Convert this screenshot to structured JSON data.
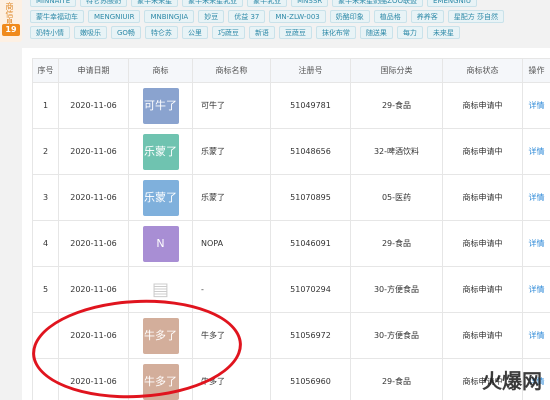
{
  "tags": {
    "row1": [
      "MINNAITE",
      "特仑苏酸奶",
      "蒙牛未来星",
      "蒙牛未来星乳业",
      "蒙牛乳业",
      "MNSSR",
      "蒙牛未来星奶酪ZOO联盟",
      "EMENGNIU"
    ],
    "row2": [
      "蒙牛幸福动车",
      "MENGNIUIR",
      "MNBINGJIA",
      "妙豆",
      "优益 37",
      "MN-ZLW-003",
      "奶酪印象",
      "植品格",
      "养养客",
      "星配方 莎自然"
    ],
    "row3": [
      "奶特小情",
      "嫩吸乐",
      "GO畅",
      "特仑苏",
      "公里",
      "巧蔬豆",
      "新语",
      "豆蔬豆",
      "抹化布常",
      "随送果",
      "每力",
      "未来星"
    ]
  },
  "side": {
    "label": "商信息",
    "count": "19"
  },
  "table": {
    "headers": [
      "序号",
      "申请日期",
      "商标",
      "商标名称",
      "注册号",
      "国际分类",
      "商标状态",
      "操作"
    ],
    "rows": [
      {
        "no": "1",
        "date": "2020-11-06",
        "logo_text": "可牛了",
        "logo_color": "#8aa3cf",
        "name": "可牛了",
        "reg": "51049781",
        "class": "29-食品",
        "status": "商标申请中",
        "action": "详情"
      },
      {
        "no": "2",
        "date": "2020-11-06",
        "logo_text": "乐蒙了",
        "logo_color": "#6fc3b0",
        "name": "乐蒙了",
        "reg": "51048656",
        "class": "32-啤酒饮料",
        "status": "商标申请中",
        "action": "详情"
      },
      {
        "no": "3",
        "date": "2020-11-06",
        "logo_text": "乐蒙了",
        "logo_color": "#7fb0dc",
        "name": "乐蒙了",
        "reg": "51070895",
        "class": "05-医药",
        "status": "商标申请中",
        "action": "详情"
      },
      {
        "no": "4",
        "date": "2020-11-06",
        "logo_text": "N",
        "logo_color": "#a88ed4",
        "name": "NOPA",
        "reg": "51046091",
        "class": "29-食品",
        "status": "商标申请中",
        "action": "详情"
      },
      {
        "no": "5",
        "date": "2020-11-06",
        "logo_text": "▤",
        "logo_color": "transparent",
        "name": "-",
        "reg": "51070294",
        "class": "30-方便食品",
        "status": "商标申请中",
        "action": "详情"
      },
      {
        "no": "",
        "date": "2020-11-06",
        "logo_text": "牛多了",
        "logo_color": "#d3ae9b",
        "name": "牛多了",
        "reg": "51056972",
        "class": "30-方便食品",
        "status": "商标申请中",
        "action": "详情"
      },
      {
        "no": "",
        "date": "2020-11-06",
        "logo_text": "牛多了",
        "logo_color": "#d3ae9b",
        "name": "牛多了",
        "reg": "51056960",
        "class": "29-食品",
        "status": "商标申请中",
        "action": "详情"
      }
    ]
  },
  "watermark": "火爆网"
}
